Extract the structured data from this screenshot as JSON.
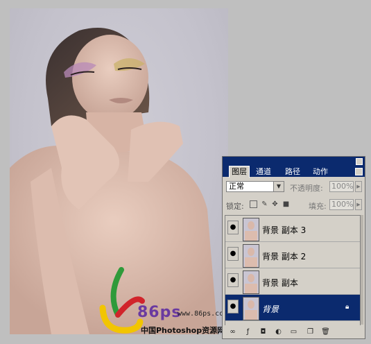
{
  "watermark": {
    "brand": "86ps",
    "url": "www.86ps.com",
    "site_name": "中国Photoshop资源网"
  },
  "layers_panel": {
    "tabs": [
      "图层",
      "通道",
      "路径",
      "动作"
    ],
    "active_tab": "图层",
    "blend_mode": "正常",
    "opacity_label": "不透明度:",
    "opacity_value": "100%",
    "lock_label": "锁定:",
    "fill_label": "填充:",
    "fill_value": "100%",
    "layers": [
      {
        "name": "背景 副本 3",
        "visible": true,
        "selected": false
      },
      {
        "name": "背景 副本 2",
        "visible": true,
        "selected": false
      },
      {
        "name": "背景 副本",
        "visible": true,
        "selected": false
      },
      {
        "name": "背景",
        "visible": true,
        "selected": true,
        "locked": true
      }
    ]
  },
  "colors": {
    "panel_bg": "#d4d0c8",
    "selection": "#0b2a6e",
    "titlebar": "#0b2a6e"
  }
}
